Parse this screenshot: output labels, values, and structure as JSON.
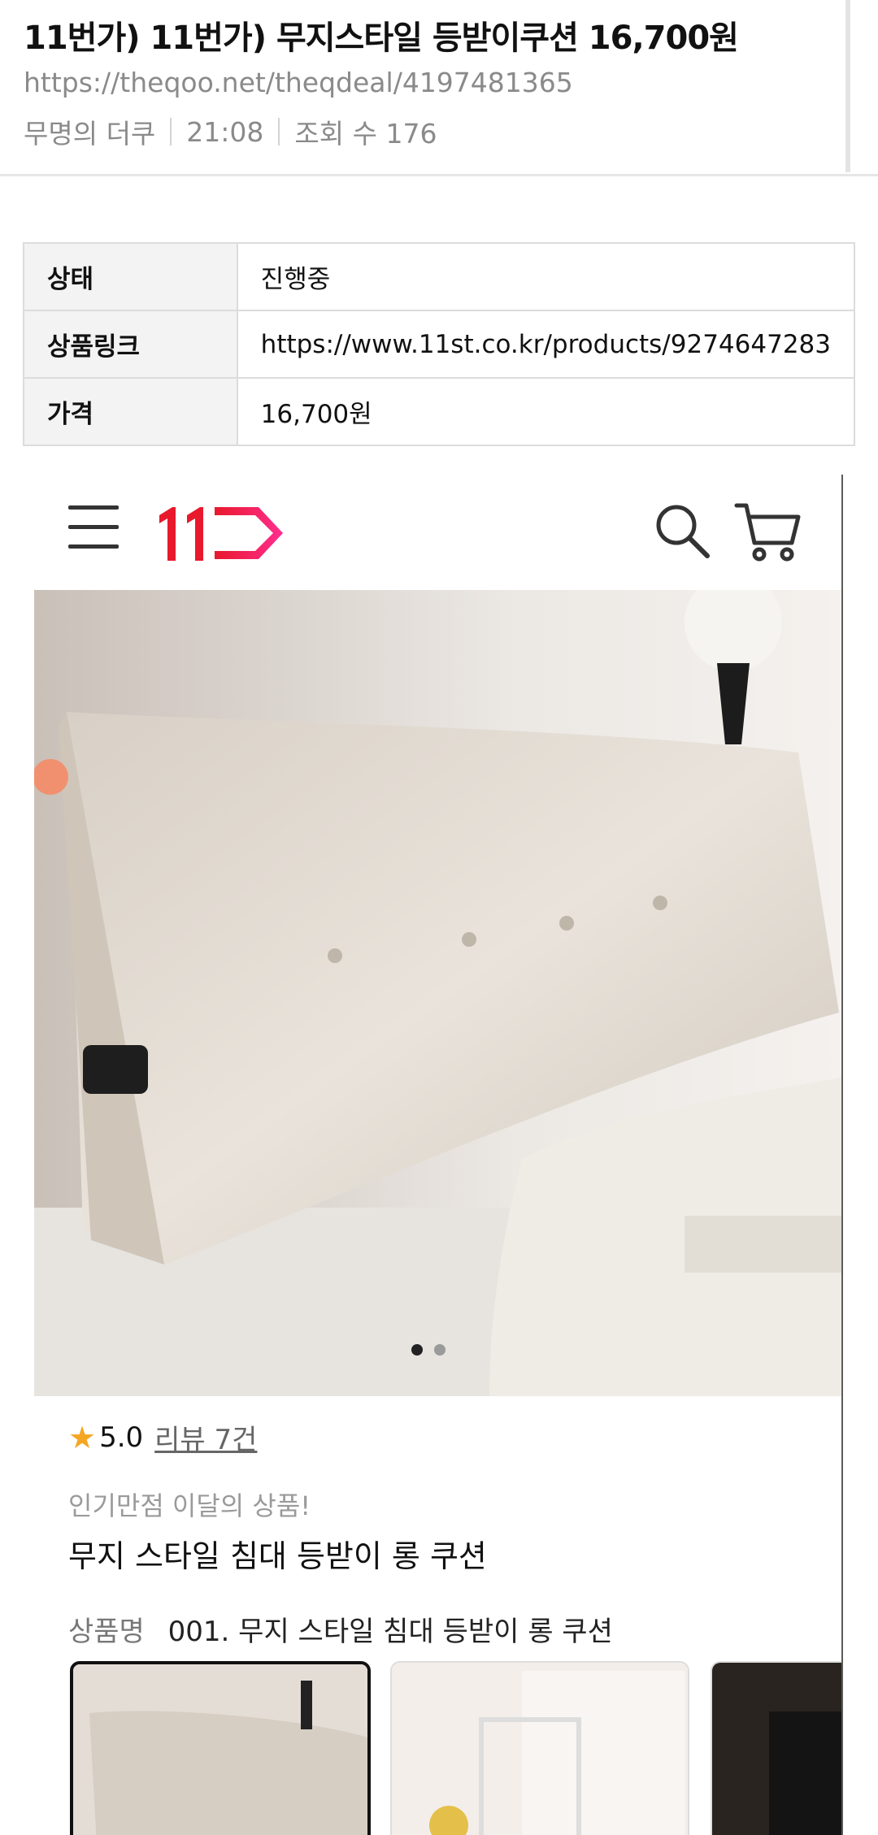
{
  "post": {
    "title": "11번가) 11번가) 무지스타일 등받이쿠션 16,700원",
    "url": "https://theqoo.net/theqdeal/4197481365",
    "author": "무명의 더쿠",
    "time": "21:08",
    "views": "조회 수 176"
  },
  "deal_table": [
    {
      "key": "상태",
      "value": "진행중"
    },
    {
      "key": "상품링크",
      "value": "https://www.11st.co.kr/products/9274647283"
    },
    {
      "key": "가격",
      "value": "16,700원"
    }
  ],
  "store": {
    "logo_icon": "11st-logo",
    "brand_color": "#e8192c",
    "logo_gradient_end": "#ff2d8f",
    "carousel": {
      "current": 1,
      "total": 2
    },
    "rating": "5.0",
    "reviews": "리뷰 7건",
    "promo": "인기만점 이달의 상품!",
    "product_name": "무지 스타일 침대 등받이 롱 쿠션",
    "option_label": "상품명",
    "option_value": "001. 무지 스타일 침대 등받이 롱 쿠션"
  }
}
